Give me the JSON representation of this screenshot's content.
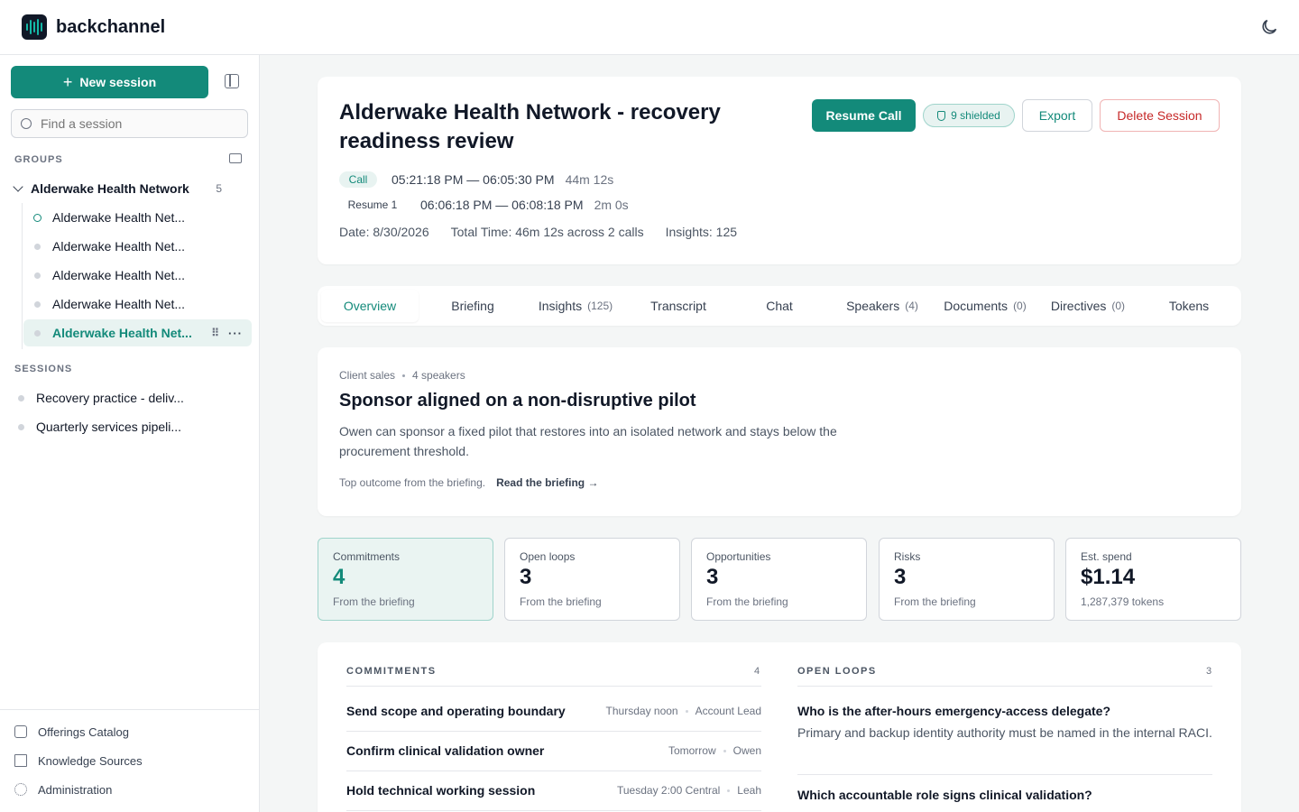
{
  "app": {
    "brand": "backchannel"
  },
  "sidebar": {
    "new_session_label": "New session",
    "search_placeholder": "Find a session",
    "groups_heading": "GROUPS",
    "sessions_heading": "SESSIONS",
    "group": {
      "label": "Alderwake Health Network",
      "count": "5"
    },
    "group_items": [
      {
        "label": "Alderwake Health Net..."
      },
      {
        "label": "Alderwake Health Net..."
      },
      {
        "label": "Alderwake Health Net..."
      },
      {
        "label": "Alderwake Health Net..."
      },
      {
        "label": "Alderwake Health Net..."
      }
    ],
    "sessions": [
      {
        "label": "Recovery practice - deliv..."
      },
      {
        "label": "Quarterly services pipeli..."
      }
    ],
    "footer": [
      {
        "label": "Offerings Catalog",
        "icon": "box-icon"
      },
      {
        "label": "Knowledge Sources",
        "icon": "book-icon"
      },
      {
        "label": "Administration",
        "icon": "gear-icon"
      }
    ]
  },
  "header": {
    "title": "Alderwake Health Network - recovery readiness review",
    "resume_label": "Resume Call",
    "shielded_label": "9 shielded",
    "export_label": "Export",
    "delete_label": "Delete Session",
    "call_tag": "Call",
    "call_range": "05:21:18 PM — 06:05:30 PM",
    "call_duration": "44m 12s",
    "resume_tag": "Resume 1",
    "resume_range": "06:06:18 PM — 06:08:18 PM",
    "resume_duration": "2m 0s",
    "date": "Date: 8/30/2026",
    "total_time": "Total Time: 46m 12s across 2 calls",
    "insights": "Insights: 125"
  },
  "tabs": [
    {
      "label": "Overview",
      "count": ""
    },
    {
      "label": "Briefing",
      "count": ""
    },
    {
      "label": "Insights",
      "count": "(125)"
    },
    {
      "label": "Transcript",
      "count": ""
    },
    {
      "label": "Chat",
      "count": ""
    },
    {
      "label": "Speakers",
      "count": "(4)"
    },
    {
      "label": "Documents",
      "count": "(0)"
    },
    {
      "label": "Directives",
      "count": "(0)"
    },
    {
      "label": "Tokens",
      "count": ""
    }
  ],
  "briefing": {
    "category": "Client sales",
    "speakers": "4 speakers",
    "title": "Sponsor aligned on a non-disruptive pilot",
    "body": "Owen can sponsor a fixed pilot that restores into an isolated network and stays below the procurement threshold.",
    "footnote": "Top outcome from the briefing.",
    "link": "Read the briefing"
  },
  "stats": [
    {
      "label": "Commitments",
      "value": "4",
      "sub": "From the briefing"
    },
    {
      "label": "Open loops",
      "value": "3",
      "sub": "From the briefing"
    },
    {
      "label": "Opportunities",
      "value": "3",
      "sub": "From the briefing"
    },
    {
      "label": "Risks",
      "value": "3",
      "sub": "From the briefing"
    },
    {
      "label": "Est. spend",
      "value": "$1.14",
      "sub": "1,287,379 tokens"
    }
  ],
  "commitments": {
    "heading": "COMMITMENTS",
    "count": "4",
    "rows": [
      {
        "title": "Send scope and operating boundary",
        "when": "Thursday noon",
        "owner": "Account Lead"
      },
      {
        "title": "Confirm clinical validation owner",
        "when": "Tomorrow",
        "owner": "Owen"
      },
      {
        "title": "Hold technical working session",
        "when": "Tuesday 2:00 Central",
        "owner": "Leah"
      }
    ]
  },
  "open_loops": {
    "heading": "OPEN LOOPS",
    "count": "3",
    "items": [
      {
        "title": "Who is the after-hours emergency-access delegate?",
        "body": "Primary and backup identity authority must be named in the internal RACI."
      },
      {
        "title": "Which accountable role signs clinical validation?",
        "body": ""
      }
    ]
  },
  "colors": {
    "accent": "#138a7a",
    "danger": "#c62828"
  }
}
